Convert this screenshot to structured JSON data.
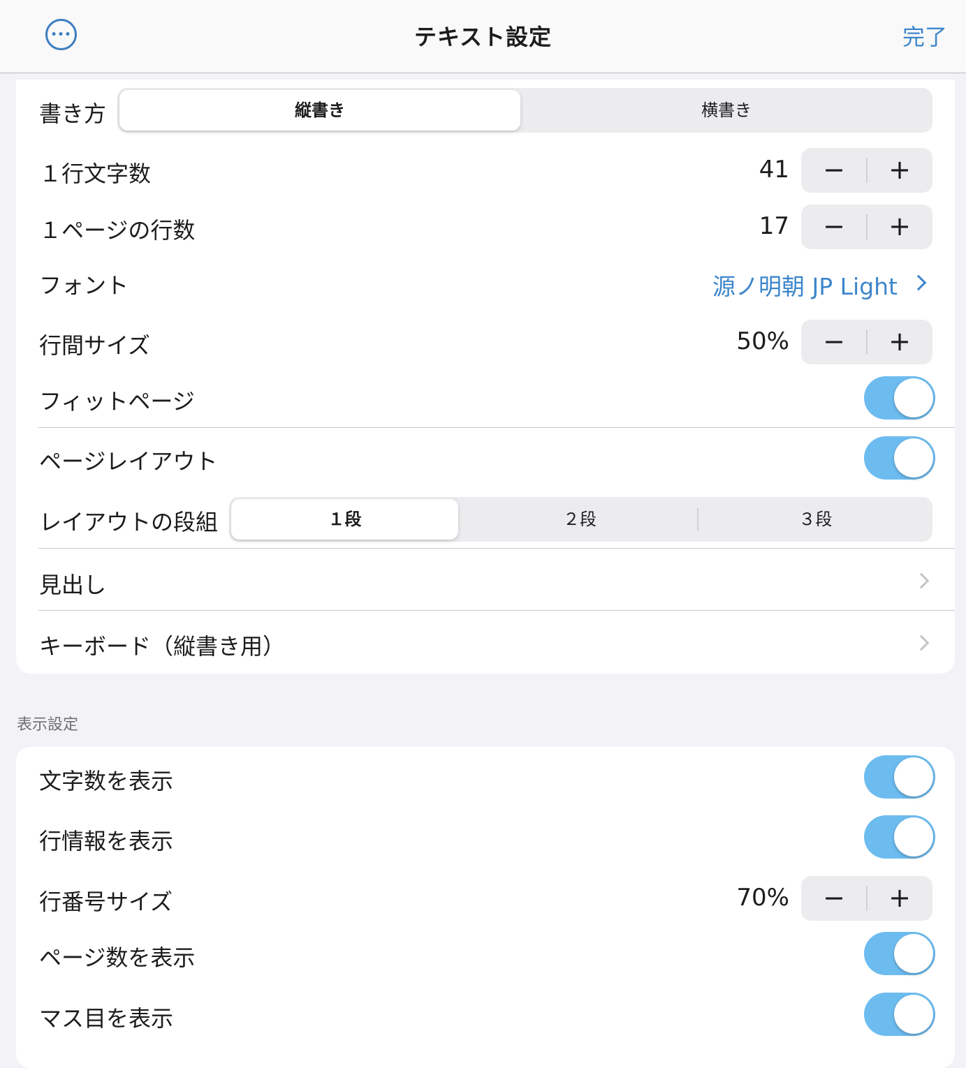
{
  "nav": {
    "title": "テキスト設定",
    "done_label": "完了",
    "more_icon": "ellipsis-circle-icon"
  },
  "writing": {
    "label": "書き方",
    "options": [
      "縦書き",
      "横書き"
    ],
    "selected": "縦書き"
  },
  "chars_per_line": {
    "label": "１行文字数",
    "value": "41"
  },
  "lines_per_page": {
    "label": "１ページの行数",
    "value": "17"
  },
  "font": {
    "label": "フォント",
    "value": "源ノ明朝 JP Light"
  },
  "line_spacing": {
    "label": "行間サイズ",
    "value": "50%"
  },
  "fit_page": {
    "label": "フィットページ",
    "on": true
  },
  "page_layout": {
    "label": "ページレイアウト",
    "on": true
  },
  "columns": {
    "label": "レイアウトの段組",
    "options": [
      "１段",
      "２段",
      "３段"
    ],
    "selected": "１段"
  },
  "headings": {
    "label": "見出し"
  },
  "keyboard": {
    "label": "キーボード（縦書き用）"
  },
  "display_section": {
    "header": "表示設定"
  },
  "show_char_count": {
    "label": "文字数を表示",
    "on": true
  },
  "show_line_info": {
    "label": "行情報を表示",
    "on": true
  },
  "line_number_size": {
    "label": "行番号サイズ",
    "value": "70%"
  },
  "show_page_count": {
    "label": "ページ数を表示",
    "on": true
  },
  "show_grid": {
    "label": "マス目を表示",
    "on": true
  },
  "stepper": {
    "minus": "−",
    "plus": "+"
  },
  "colors": {
    "accent": "#3d86cb",
    "toggle_on": "#6dbcf0"
  }
}
